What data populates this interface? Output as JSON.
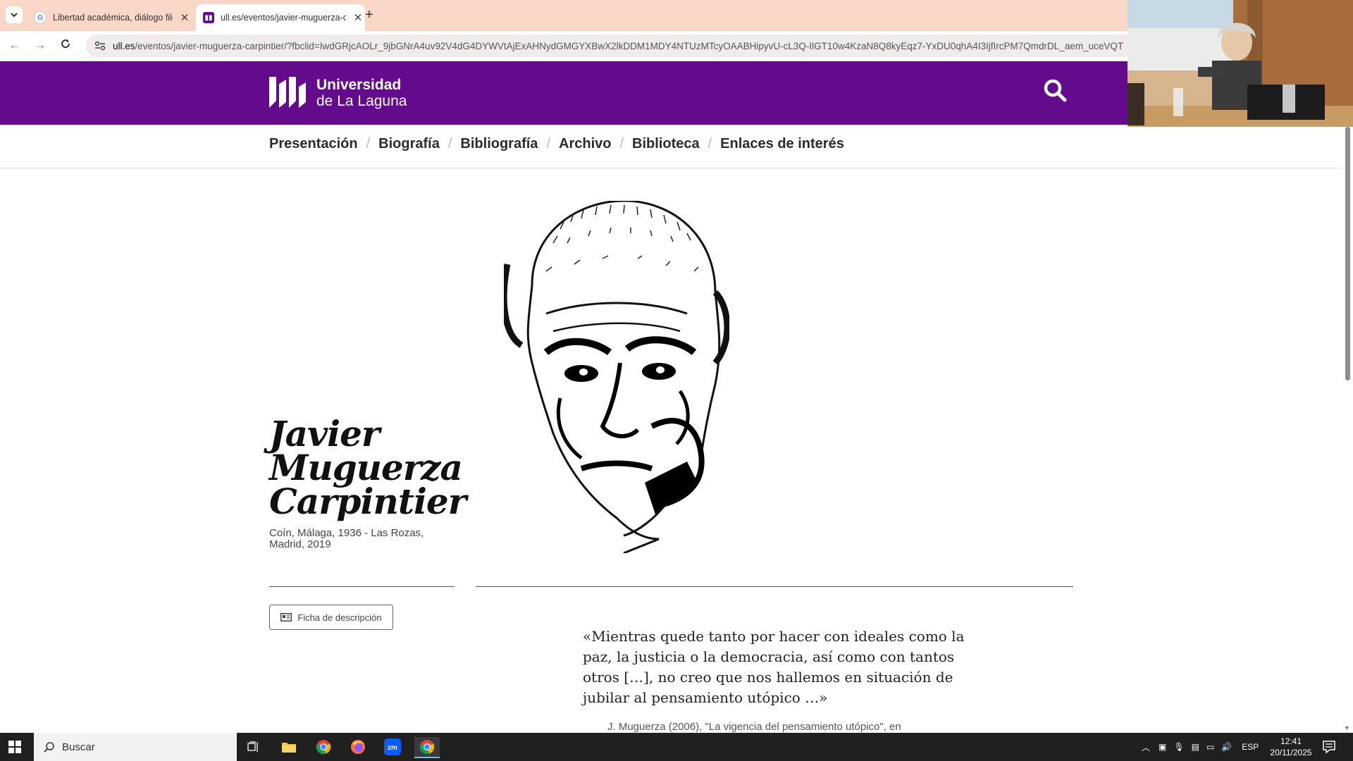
{
  "browser": {
    "tabs": [
      {
        "title": "Libertad académica, diálogo filosófico",
        "favicon": "google-icon"
      },
      {
        "title": "ull.es/eventos/javier-muguerza-carpintier",
        "favicon": "ull-icon",
        "active": true
      }
    ],
    "url_host": "ull.es",
    "url_path": "/eventos/javier-muguerza-carpintier/?fbclid=IwdGRjcAOLr_9jbGNrA4uv92V4dG4DYWVtAjExAHNydGMGYXBwX2lkDDM1MDY4NTUzMTcyOAABHipyvU-cL3Q-IlGT10w4KzaN8Q8kyEqz7-YxDU0qhA4I3IjfIrcPM7QmdrDL_aem_uceVQT"
  },
  "site": {
    "logo_line1": "Universidad",
    "logo_line2": "de La Laguna",
    "nav": [
      "Presentación",
      "Biografía",
      "Bibliografía",
      "Archivo",
      "Biblioteca",
      "Enlaces de interés"
    ],
    "colors": {
      "brand": "#640a8c"
    }
  },
  "hero": {
    "name_lines": [
      "Javier",
      "Muguerza",
      "Carpintier"
    ],
    "dates": "Coín, Málaga, 1936 - Las Rozas, Madrid, 2019",
    "ficha_label": "Ficha de descripción",
    "quote": "«Mientras quede tanto por hacer con ideales como la paz, la justicia o la democracia, así como con tantos otros […], no creo que nos hallemos en situación de jubilar al pensamiento utópico …»",
    "citation": "J. Muguerza (2006), \"La vigencia del pensamiento utópico\", en"
  },
  "taskbar": {
    "search_placeholder": "Buscar",
    "language": "ESP",
    "time": "12:41",
    "date": "20/11/2025"
  }
}
